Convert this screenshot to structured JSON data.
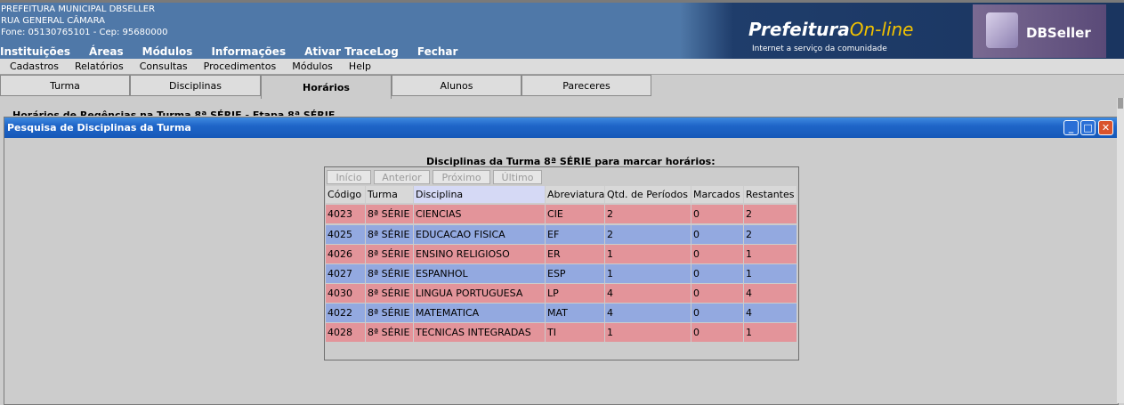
{
  "header": {
    "org_line1": "PREFEITURA MUNICIPAL DBSELLER",
    "org_line2": "RUA GENERAL CÂMARA",
    "org_line3": "Fone: 05130765101  -  Cep: 95680000",
    "logo_prefeitura": "Prefeitura",
    "logo_online": "On-line",
    "logo_tagline": "Internet a serviço da comunidade",
    "logo_dbseller": "DBSeller"
  },
  "main_menu": [
    "Instituições",
    "Áreas",
    "Módulos",
    "Informações",
    "Ativar TraceLog",
    "Fechar"
  ],
  "sub_menu": [
    "Cadastros",
    "Relatórios",
    "Consultas",
    "Procedimentos",
    "Módulos",
    "Help"
  ],
  "tabs": [
    "Turma",
    "Disciplinas",
    "Horários",
    "Alunos",
    "Pareceres"
  ],
  "active_tab": "Horários",
  "background_title": "Horários de Regências na Turma 8ª SÉRIE - Etapa 8ª SÉRIE",
  "window": {
    "title": "Pesquisa de Disciplinas da Turma",
    "btn_min": "_",
    "btn_max": "□",
    "btn_close": "✕"
  },
  "grid": {
    "title": "Disciplinas da Turma 8ª SÉRIE para marcar horários:",
    "pager": [
      "Início",
      "Anterior",
      "Próximo",
      "Último"
    ],
    "columns": [
      "Código",
      "Turma",
      "Disciplina",
      "Abreviatura",
      "Qtd. de Períodos",
      "Marcados",
      "Restantes"
    ],
    "rows": [
      [
        "4023",
        "8ª SÉRIE",
        "CIENCIAS",
        "CIE",
        "2",
        "0",
        "2"
      ],
      [
        "4025",
        "8ª SÉRIE",
        "EDUCACAO FISICA",
        "EF",
        "2",
        "0",
        "2"
      ],
      [
        "4026",
        "8ª SÉRIE",
        "ENSINO RELIGIOSO",
        "ER",
        "1",
        "0",
        "1"
      ],
      [
        "4027",
        "8ª SÉRIE",
        "ESPANHOL",
        "ESP",
        "1",
        "0",
        "1"
      ],
      [
        "4030",
        "8ª SÉRIE",
        "LINGUA PORTUGUESA",
        "LP",
        "4",
        "0",
        "4"
      ],
      [
        "4022",
        "8ª SÉRIE",
        "MATEMATICA",
        "MAT",
        "4",
        "0",
        "4"
      ],
      [
        "4028",
        "8ª SÉRIE",
        "TECNICAS INTEGRADAS",
        "TI",
        "1",
        "0",
        "1"
      ]
    ]
  },
  "colors": {
    "row_pink": "#e3949a",
    "row_blue": "#93a9e0",
    "header_bg": "#4f78a8",
    "titlebar": "#1f65c8"
  }
}
